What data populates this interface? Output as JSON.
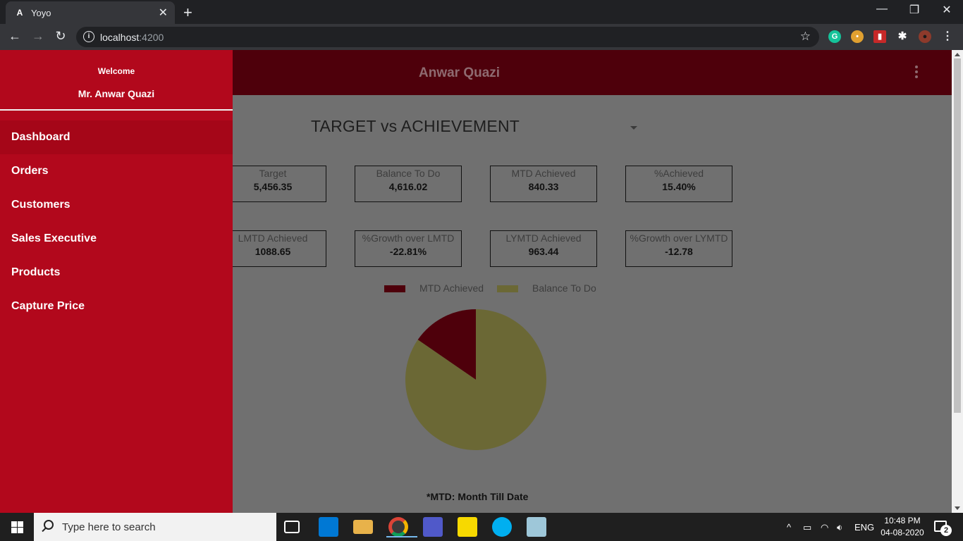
{
  "browser": {
    "tab_title": "Yoyo",
    "tab_favicon": "A",
    "tab_close": "✕",
    "new_tab": "+",
    "url_host": "localhost",
    "url_port": ":4200",
    "window_controls": {
      "minimize": "—",
      "restore": "❐",
      "close": "✕"
    },
    "extensions": [
      "G",
      "•",
      "▮",
      "✱",
      "●"
    ]
  },
  "header": {
    "user_name": "Anwar Quazi"
  },
  "sidebar": {
    "welcome": "Welcome",
    "user": "Mr. Anwar Quazi",
    "items": [
      {
        "label": "Dashboard",
        "active": true
      },
      {
        "label": "Orders"
      },
      {
        "label": "Customers"
      },
      {
        "label": "Sales Executive"
      },
      {
        "label": "Products"
      },
      {
        "label": "Capture Price"
      }
    ]
  },
  "main": {
    "title": "TARGET vs ACHIEVEMENT",
    "kpis": [
      {
        "label": "Target",
        "value": "5,456.35"
      },
      {
        "label": "Balance To Do",
        "value": "4,616.02"
      },
      {
        "label": "MTD Achieved",
        "value": "840.33"
      },
      {
        "label": "%Achieved",
        "value": "15.40%"
      },
      {
        "label": "LMTD Achieved",
        "value": "1088.65"
      },
      {
        "label": "%Growth over LMTD",
        "value": "-22.81%"
      },
      {
        "label": "LYMTD Achieved",
        "value": "963.44"
      },
      {
        "label": "%Growth over LYMTD",
        "value": "-12.78"
      }
    ],
    "footnote": "*MTD: Month Till Date"
  },
  "chart_data": {
    "type": "pie",
    "categories": [
      "MTD Achieved",
      "Balance To Do"
    ],
    "values": [
      840.33,
      4616.02
    ],
    "colors": [
      "#4e000b",
      "#6b6835"
    ],
    "legend": "top"
  },
  "taskbar": {
    "search_placeholder": "Type here to search",
    "language": "ENG",
    "time": "10:48 PM",
    "date": "04-08-2020",
    "notifications": "2"
  }
}
